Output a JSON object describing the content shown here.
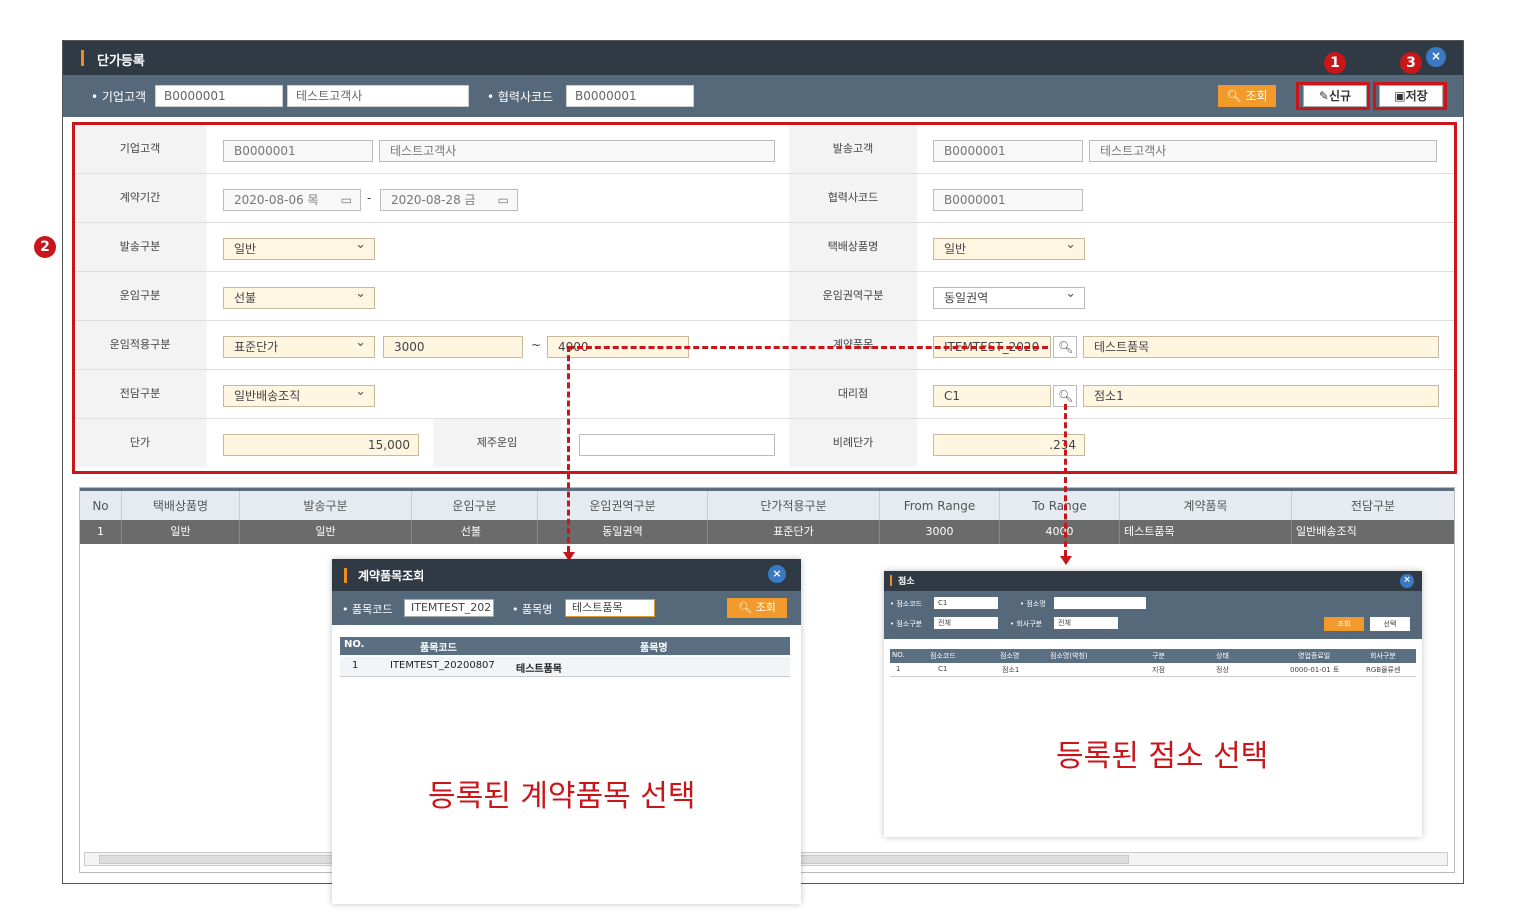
{
  "window": {
    "title": "단가등록",
    "close": "×"
  },
  "search": {
    "company_label": "• 기업고객",
    "company_code": "B0000001",
    "company_name": "테스트고객사",
    "partner_label": "• 협력사코드",
    "partner_code": "B0000001",
    "query_btn": "조회",
    "new_btn": "신규",
    "save_btn": "저장"
  },
  "markers": {
    "m1": "1",
    "m2": "2",
    "m3": "3"
  },
  "form": {
    "company_label": "기업고객",
    "company_code": "B0000001",
    "company_name": "테스트고객사",
    "sender_label": "발송고객",
    "sender_code": "B0000001",
    "sender_name": "테스트고객사",
    "period_label": "계약기간",
    "period_from": "2020-08-06 목",
    "period_sep": "-",
    "period_to": "2020-08-28 금",
    "partner_label": "협력사코드",
    "partner_code": "B0000001",
    "ship_type_label": "발송구분",
    "ship_type": "일반",
    "product_label": "택배상품명",
    "product": "일반",
    "fare_type_label": "운임구분",
    "fare_type": "선불",
    "fare_zone_label": "운임권역구분",
    "fare_zone": "동일권역",
    "fare_apply_label": "운임적용구분",
    "fare_apply": "표준단가",
    "range_from": "3000",
    "range_sep": "~",
    "range_to": "4000",
    "item_label": "계약품목",
    "item_code": "ITEMTEST_2020",
    "item_name": "테스트품목",
    "owner_label": "전담구분",
    "owner": "일반배송조직",
    "agency_label": "대리점",
    "agency_code": "C1",
    "agency_name": "점소1",
    "price_label": "단가",
    "price": "15,000",
    "jeju_label": "제주운임",
    "jeju": "",
    "ratio_label": "비례단가",
    "ratio": ".234"
  },
  "grid": {
    "headers": [
      "No",
      "택배상품명",
      "발송구분",
      "운임구분",
      "운임권역구분",
      "단가적용구분",
      "From Range",
      "To Range",
      "계약품목",
      "전담구분"
    ],
    "rows": [
      [
        "1",
        "일반",
        "일반",
        "선불",
        "동일권역",
        "표준단가",
        "3000",
        "4000",
        "테스트품목",
        "일반배송조직"
      ]
    ]
  },
  "popup1": {
    "title": "계약품목조회",
    "code_label": "• 품목코드",
    "code": "ITEMTEST_202",
    "name_label": "• 품목명",
    "name": "테스트품목",
    "query_btn": "조회",
    "headers": [
      "NO.",
      "품목코드",
      "품목명"
    ],
    "rows": [
      [
        "1",
        "ITEMTEST_20200807",
        "테스트품목"
      ]
    ]
  },
  "popup2": {
    "title": "점소",
    "code_label": "• 점소코드",
    "code": "C1",
    "name_label": "• 점소명",
    "name": "",
    "type_label": "• 점소구분",
    "type": "전체",
    "comp_label": "• 회사구분",
    "comp": "전체",
    "query_btn": "조회",
    "select_btn": "선택",
    "headers": [
      "NO.",
      "점소코드",
      "점소명",
      "점소명(약칭)",
      "구분",
      "상태",
      "영업종료일",
      "회사구분"
    ],
    "rows": [
      [
        "1",
        "C1",
        "점소1",
        "",
        "지점",
        "정상",
        "0000-01-01 토",
        "RGB물류센"
      ]
    ]
  },
  "notes": {
    "item": "등록된 계약품목 선택",
    "agency": "등록된 점소 선택"
  },
  "colors": {
    "accent": "#c9161b",
    "orange": "#f29b2c",
    "header": "#2f3a44"
  }
}
